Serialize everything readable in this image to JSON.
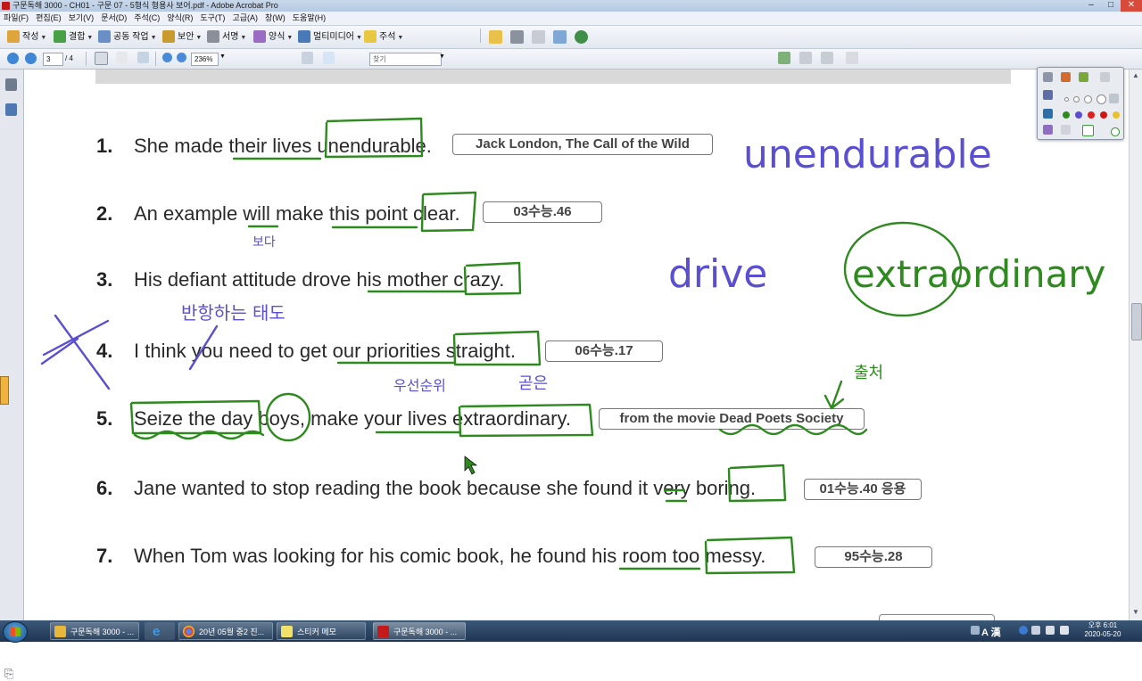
{
  "window": {
    "title": "구문독해 3000 - CH01 - 구문 07 - 5형식 형용사 보어.pdf - Adobe Acrobat Pro",
    "controls": {
      "minimize": "–",
      "maximize": "□",
      "close": "✕"
    }
  },
  "menu": [
    "파일(F)",
    "편집(E)",
    "보기(V)",
    "문서(D)",
    "주석(C)",
    "양식(R)",
    "도구(T)",
    "고급(A)",
    "창(W)",
    "도움말(H)"
  ],
  "toolbar1": {
    "create": "작성",
    "combine": "결합",
    "collaborate": "공동 작업",
    "secure": "보안",
    "sign": "서명",
    "forms": "양식",
    "multimedia": "멀티미디어",
    "comment": "주석"
  },
  "toolbar2": {
    "page_current": "3",
    "page_total": "/ 4",
    "zoom": "236%",
    "find_placeholder": "찾기"
  },
  "document": {
    "sentences": [
      {
        "num": "1.",
        "text": "She made their lives unendurable.",
        "source": "Jack London, The Call of the Wild"
      },
      {
        "num": "2.",
        "text": "An example will make this point clear.",
        "source": "03수능.46"
      },
      {
        "num": "3.",
        "text": "His defiant attitude drove his mother crazy.",
        "source": ""
      },
      {
        "num": "4.",
        "text": "I think you need to get our priorities straight.",
        "source": "06수능.17"
      },
      {
        "num": "5.",
        "text": "Seize the day boys, make your lives extraordinary.",
        "source": "from the movie Dead Poets Society"
      },
      {
        "num": "6.",
        "text": "Jane wanted to stop reading the book because she found it very boring.",
        "source": "01수능.40 응용"
      },
      {
        "num": "7.",
        "text": "When Tom was looking for his comic book, he found his room too messy.",
        "source": "95수능.28"
      }
    ],
    "annotations": {
      "unendurable": "unendurable",
      "drive": "drive",
      "extraordinary": "extraordinary",
      "extra": "extra",
      "will_note": "보다",
      "defiant_note": "반항하는 태도",
      "priorities_note": "우선순위",
      "straight_note": "곧은",
      "from_note": "출처"
    }
  },
  "colors": {
    "ink_green": "#2e8a1f",
    "ink_purple": "#5a4fd0",
    "text": "#2a2a2a"
  },
  "taskbar": {
    "tasks": [
      {
        "label": "구문독해 3000 - ...",
        "icon": "folder-icon"
      },
      {
        "label": "",
        "icon": "ie-icon"
      },
      {
        "label": "20년 05월 중2 진...",
        "icon": "chrome-icon"
      },
      {
        "label": "스티커 메모",
        "icon": "sticky-notes-icon"
      },
      {
        "label": "구문독해 3000 - ...",
        "icon": "acrobat-icon"
      }
    ],
    "ime": "A 漢",
    "time": "오후 6:01",
    "date": "2020-05-20"
  }
}
